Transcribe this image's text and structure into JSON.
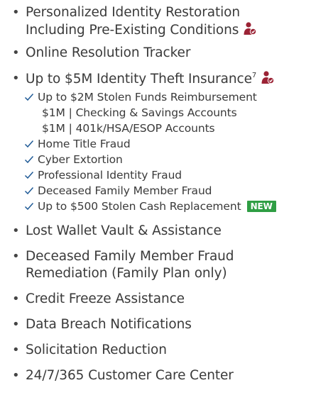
{
  "features": {
    "item1_line1": "Personalized Identity Restoration",
    "item1_line2": "Including Pre-Existing Conditions",
    "item2": "Online Resolution Tracker",
    "item3": "Up to $5M Identity Theft Insurance",
    "item3_sup": "7",
    "insurance_sub": {
      "stolen_funds": "Up to $2M Stolen Funds Reimbursement",
      "checking": "$1M | Checking & Savings Accounts",
      "retirement": "$1M | 401k/HSA/ESOP Accounts",
      "home_title": "Home Title Fraud",
      "cyber": "Cyber Extortion",
      "professional": "Professional Identity Fraud",
      "deceased": "Deceased Family Member Fraud",
      "cash": "Up to $500 Stolen Cash Replacement",
      "new_badge": "NEW"
    },
    "item4": "Lost Wallet Vault & Assistance",
    "item5_line1": "Deceased Family Member Fraud",
    "item5_line2": "Remediation (Family Plan only)",
    "item6": "Credit Freeze Assistance",
    "item7": "Data Breach Notifications",
    "item8": "Solicitation Reduction",
    "item9": "24/7/365 Customer Care Center"
  },
  "icons": {
    "person": "person-icon",
    "check": "check-icon"
  },
  "colors": {
    "text": "#3a3a3a",
    "accent_maroon": "#9b2335",
    "check_blue": "#1f5a96",
    "badge_green": "#2f9e44"
  }
}
